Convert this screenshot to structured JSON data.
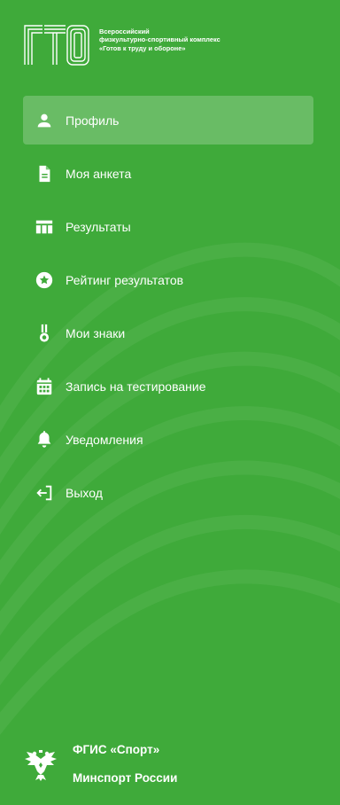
{
  "brand": {
    "logo_text": "ГТО",
    "lines": [
      "Всероссийский",
      "физкультурно-спортивный комплекс",
      "«Готов к труду и обороне»"
    ]
  },
  "menu": {
    "items": [
      {
        "label": "Профиль",
        "icon": "person-icon",
        "active": true
      },
      {
        "label": "Моя анкета",
        "icon": "document-icon",
        "active": false
      },
      {
        "label": "Результаты",
        "icon": "table-icon",
        "active": false
      },
      {
        "label": "Рейтинг результатов",
        "icon": "star-badge-icon",
        "active": false
      },
      {
        "label": "Мои знаки",
        "icon": "medal-icon",
        "active": false
      },
      {
        "label": "Запись на тестирование",
        "icon": "calendar-icon",
        "active": false
      },
      {
        "label": "Уведомления",
        "icon": "bell-icon",
        "active": false
      },
      {
        "label": "Выход",
        "icon": "logout-icon",
        "active": false
      }
    ]
  },
  "footer": {
    "line1": "ФГИС «Спорт»",
    "line2": "Минспорт России",
    "emblem": "double-headed-eagle-emblem"
  },
  "colors": {
    "background": "#3faa3a",
    "active_item_bg": "rgba(255,255,255,0.22)",
    "text": "#ffffff"
  }
}
